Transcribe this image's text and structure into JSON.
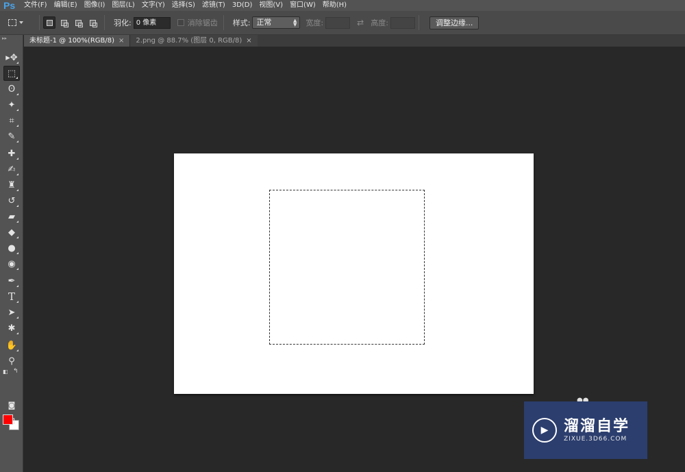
{
  "app": {
    "logo": "Ps"
  },
  "menu": [
    "文件(F)",
    "编辑(E)",
    "图像(I)",
    "图层(L)",
    "文字(Y)",
    "选择(S)",
    "滤镜(T)",
    "3D(D)",
    "视图(V)",
    "窗口(W)",
    "帮助(H)"
  ],
  "options": {
    "feather_label": "羽化:",
    "feather_value": "0 像素",
    "antialias_label": "消除锯齿",
    "style_label": "样式:",
    "style_value": "正常",
    "width_label": "宽度:",
    "height_label": "高度:",
    "refine_edge": "调整边缘..."
  },
  "tabs": [
    {
      "title": "未标题-1 @ 100%(RGB/8)",
      "close": "×",
      "active": true
    },
    {
      "title": "2.png @ 88.7% (图层 0, RGB/8)",
      "close": "×",
      "active": false
    }
  ],
  "tools": [
    {
      "name": "move-tool",
      "glyph": "▸✥"
    },
    {
      "name": "rect-marquee-tool",
      "glyph": "⬚"
    },
    {
      "name": "lasso-tool",
      "glyph": "ʘ"
    },
    {
      "name": "magic-wand-tool",
      "glyph": "✦"
    },
    {
      "name": "crop-tool",
      "glyph": "⌗"
    },
    {
      "name": "eyedropper-tool",
      "glyph": "✎"
    },
    {
      "name": "healing-brush-tool",
      "glyph": "✚"
    },
    {
      "name": "brush-tool",
      "glyph": "✍"
    },
    {
      "name": "clone-stamp-tool",
      "glyph": "♜"
    },
    {
      "name": "history-brush-tool",
      "glyph": "↺"
    },
    {
      "name": "eraser-tool",
      "glyph": "▰"
    },
    {
      "name": "paint-bucket-tool",
      "glyph": "◆"
    },
    {
      "name": "blur-tool",
      "glyph": "●"
    },
    {
      "name": "dodge-tool",
      "glyph": "◉"
    },
    {
      "name": "pen-tool",
      "glyph": "✒"
    },
    {
      "name": "type-tool",
      "glyph": "T"
    },
    {
      "name": "path-selection-tool",
      "glyph": "➤"
    },
    {
      "name": "custom-shape-tool",
      "glyph": "✱"
    },
    {
      "name": "hand-tool",
      "glyph": "✋"
    },
    {
      "name": "zoom-tool",
      "glyph": "⚲"
    }
  ],
  "colors": {
    "foreground": "#ff0000",
    "background": "#ffffff",
    "accent": "#4aa3e8"
  },
  "watermark": {
    "title": "溜溜自学",
    "url": "ZIXUE.3D66.COM"
  }
}
